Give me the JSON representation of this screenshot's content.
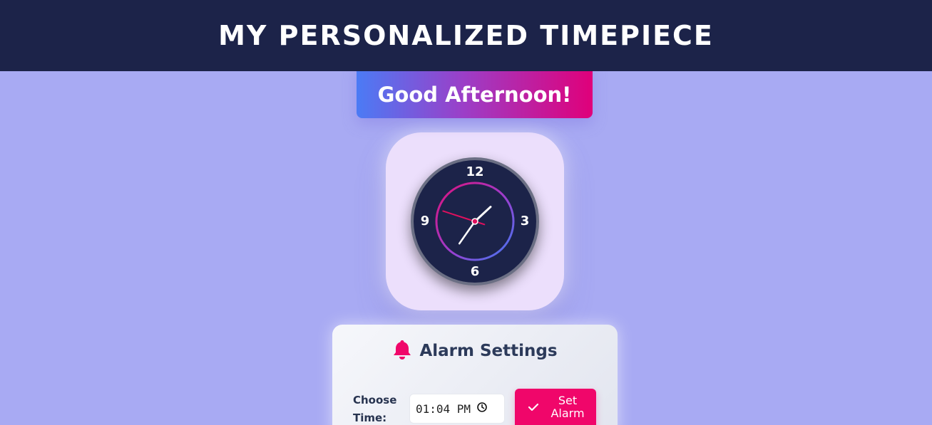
{
  "header": {
    "title": "MY PERSONALIZED TIMEPIECE"
  },
  "greeting": {
    "text": "Good Afternoon!"
  },
  "clock": {
    "numbers": {
      "twelve": "12",
      "three": "3",
      "six": "6",
      "nine": "9"
    },
    "hour_hand_deg": 47,
    "minute_hand_deg": 215,
    "second_hand_deg": 288
  },
  "alarm": {
    "title": "Alarm Settings",
    "bell_icon": "bell-icon",
    "choose_label_line1": "Choose",
    "choose_label_line2": "Time:",
    "time_value": "01:04 PM",
    "clock_icon": "clock-icon",
    "set_button_line1": "Set",
    "set_button_line2": "Alarm",
    "check_icon": "check-icon"
  },
  "colors": {
    "header_bg": "#1c2349",
    "page_bg": "#a8aaf3",
    "accent": "#f0066a",
    "clock_card_bg": "#ecdffc"
  }
}
